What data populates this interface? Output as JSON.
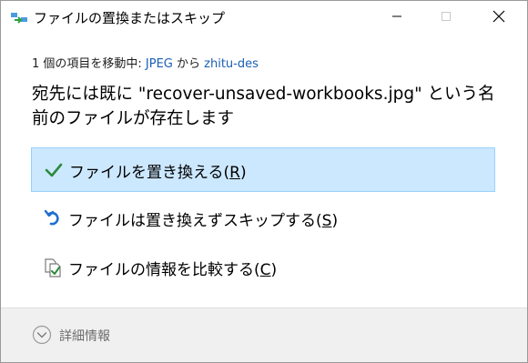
{
  "window": {
    "title": "ファイルの置換またはスキップ"
  },
  "move_info": {
    "prefix": "1 個の項目を移動中: ",
    "source": "JPEG",
    "middle": " から ",
    "destination": "zhitu-des"
  },
  "headline": "宛先には既に \"recover-unsaved-workbooks.jpg\" という名前のファイルが存在します",
  "options": [
    {
      "label": "ファイルを置き換える(",
      "accel": "R",
      "close": ")",
      "icon": "checkmark-icon",
      "selected": true
    },
    {
      "label": "ファイルは置き換えずスキップする(",
      "accel": "S",
      "close": ")",
      "icon": "skip-arrow-icon",
      "selected": false
    },
    {
      "label": "ファイルの情報を比較する(",
      "accel": "C",
      "close": ")",
      "icon": "compare-files-icon",
      "selected": false
    }
  ],
  "footer": {
    "details_label": "詳細情報",
    "icon": "chevron-down-circle-icon"
  },
  "colors": {
    "selected_bg": "#cce8ff",
    "selected_border": "#99d1ff",
    "link": "#1a5fb4",
    "check": "#2b8a3e",
    "skip_arrow": "#1f6fd1"
  }
}
